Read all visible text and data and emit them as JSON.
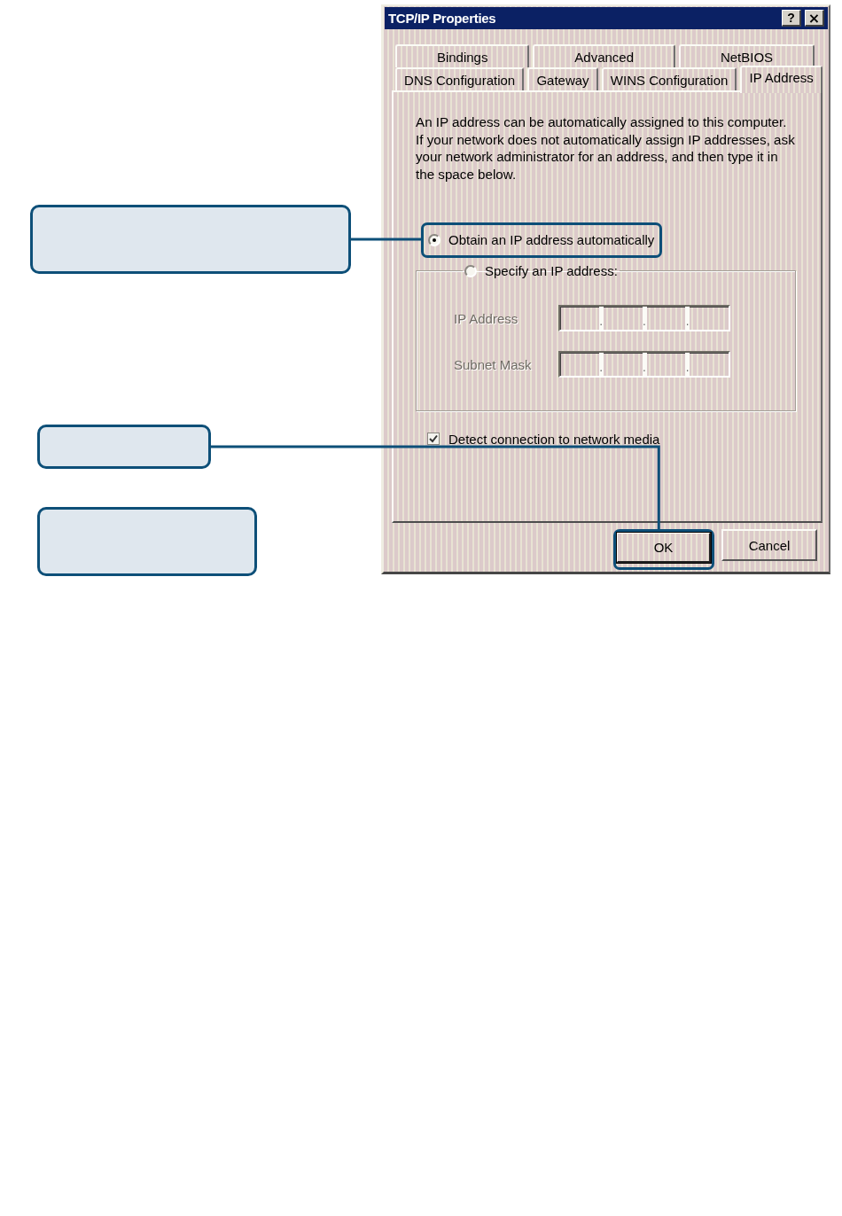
{
  "window": {
    "title": "TCP/IP Properties",
    "title_buttons": [
      {
        "kind": "help",
        "label": "?"
      },
      {
        "kind": "close",
        "label": "×"
      }
    ]
  },
  "tab_rows": [
    [
      {
        "label": "Bindings",
        "selected": false
      },
      {
        "label": "Advanced",
        "selected": false
      },
      {
        "label": "NetBIOS",
        "selected": false
      }
    ],
    [
      {
        "label": "DNS Configuration",
        "selected": false
      },
      {
        "label": "Gateway",
        "selected": false
      },
      {
        "label": "WINS Configuration",
        "selected": false
      },
      {
        "label": "IP Address",
        "selected": true
      }
    ]
  ],
  "description": "An IP address can be automatically assigned to this computer. If your network does not automatically assign IP addresses, ask your network administrator for an address, and then type it in the space below.",
  "auto_option": {
    "label": "Obtain an IP address automatically",
    "selected": true,
    "highlighted": true
  },
  "manual_group": {
    "option": {
      "label": "Specify an IP address:",
      "selected": false
    },
    "fields": [
      {
        "label": "IP Address",
        "disabled": true,
        "separators": [
          ".",
          ".",
          "."
        ]
      },
      {
        "label": "Subnet Mask",
        "disabled": true,
        "separators": [
          ".",
          ".",
          "."
        ]
      }
    ]
  },
  "media_checkbox": {
    "label": "Detect connection to network media",
    "checked": true
  },
  "buttons": [
    {
      "label": "OK",
      "default": true,
      "highlighted": true
    },
    {
      "label": "Cancel",
      "default": false,
      "highlighted": false
    }
  ]
}
